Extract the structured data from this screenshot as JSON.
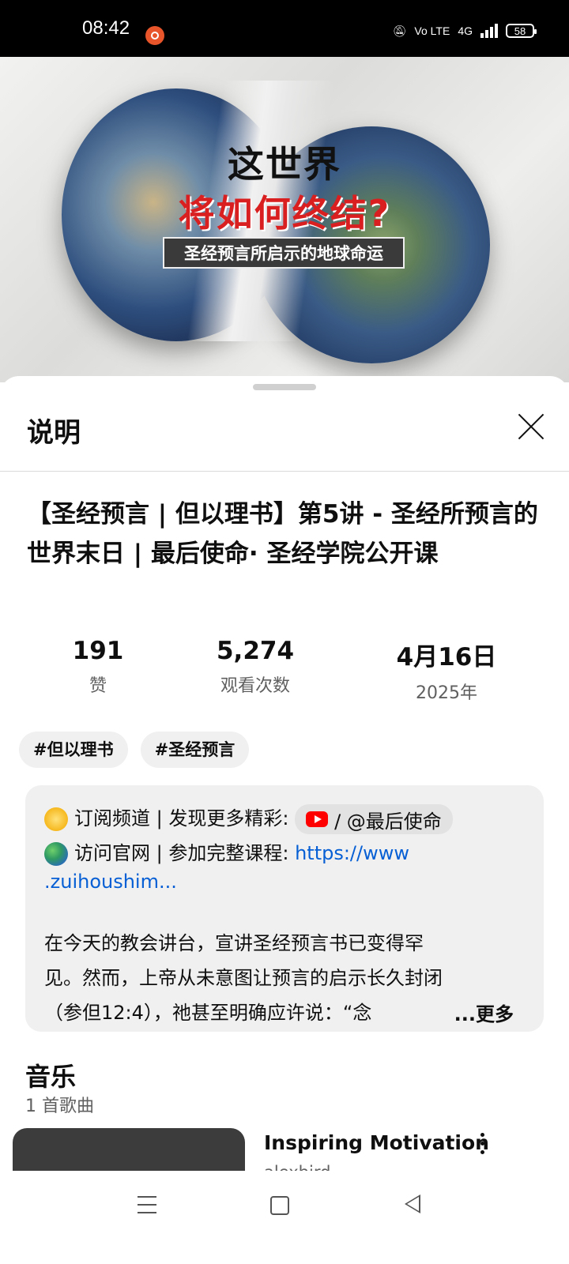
{
  "status_bar": {
    "time": "08:42",
    "network": "4G",
    "volte": "Vo LTE",
    "battery": "58"
  },
  "thumbnail": {
    "title_line1": "这世界",
    "title_line2": "将如何终结?",
    "subtitle": "圣经预言所启示的地球命运"
  },
  "sheet": {
    "title": "说明",
    "video_title": "【圣经预言 | 但以理书】第5讲 - 圣经所预言的世界末日 | 最后使命· 圣经学院公开课",
    "stats": [
      {
        "value": "191",
        "label": "赞"
      },
      {
        "value": "5,274",
        "label": "观看次数"
      },
      {
        "value": "4月16日",
        "label": "2025年"
      }
    ],
    "tags": [
      "#但以理书",
      "#圣经预言"
    ],
    "description": {
      "line1_text": "订阅频道 | 发现更多精彩:",
      "channel_handle": "/ @最后使命",
      "line2_text": "访问官网 | 参加完整课程:",
      "link_part1": "https://www",
      "link_part2": ".zuihoushim...",
      "para_line1": "在今天的教会讲台，宣讲圣经预言书已变得罕",
      "para_line2": "见。然而，上帝从未意图让预言的启示长久封闭",
      "para_line3": "（参但12:4），祂甚至明确应许说：“念",
      "more": "...更多"
    },
    "music": {
      "title": "音乐",
      "count": "1 首歌曲",
      "song_title": "Inspiring Motivation",
      "song_artist": "alexbird"
    }
  },
  "icons": {
    "star": "star-emoji",
    "globe": "globe-emoji",
    "youtube": "youtube-icon"
  }
}
